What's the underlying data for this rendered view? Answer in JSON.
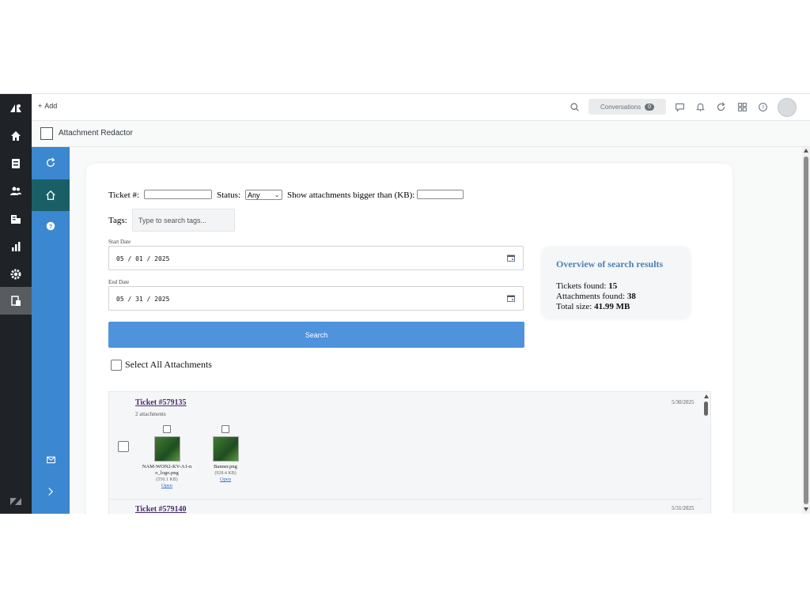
{
  "header": {
    "add_label": "Add",
    "conversations_label": "Conversations",
    "conversations_count": "0"
  },
  "app": {
    "title": "Attachment Redactor"
  },
  "filters": {
    "ticket_label": "Ticket #:",
    "status_label": "Status:",
    "status_value": "Any",
    "bigger_label": "Show attachments bigger than (KB):",
    "tags_label": "Tags:",
    "tags_placeholder": "Type to search tags...",
    "start_label": "Start Date",
    "start_value": "05 / 01 / 2025",
    "end_label": "End Date",
    "end_value": "05 / 31 / 2025",
    "search_label": "Search",
    "select_all_label": "Select All Attachments"
  },
  "overview": {
    "title": "Overview of search results",
    "tickets_label": "Tickets found:",
    "tickets_value": "15",
    "attachments_label": "Attachments found:",
    "attachments_value": "38",
    "size_label": "Total size:",
    "size_value": "41.99 MB"
  },
  "tickets": [
    {
      "title": "Ticket #579135",
      "count": "2 attachments",
      "date": "5/30/2025",
      "attachments": [
        {
          "filename_line1": "NAM-WON2-KV-A1-n",
          "filename_line2": "o_logo.png",
          "size": "(550.1 KB)",
          "open": "Open"
        },
        {
          "filename_line1": "Banner.png",
          "filename_line2": "",
          "size": "(928.4 KB)",
          "open": "Open"
        }
      ]
    },
    {
      "title": "Ticket #579140",
      "date": "5/31/2025"
    }
  ],
  "icons": {
    "nav": [
      "zendesk-logo-icon",
      "home-icon",
      "inbox-icon",
      "users-icon",
      "organizations-icon",
      "reports-icon",
      "settings-icon",
      "apps-icon",
      "zendesk-bottom-icon"
    ],
    "top": [
      "search-icon",
      "chat-icon",
      "bell-icon",
      "refresh-icon",
      "grid-icon",
      "help-icon"
    ],
    "side": [
      "refresh-icon",
      "home-icon",
      "help-icon",
      "mail-icon",
      "chevron-right-icon"
    ]
  }
}
